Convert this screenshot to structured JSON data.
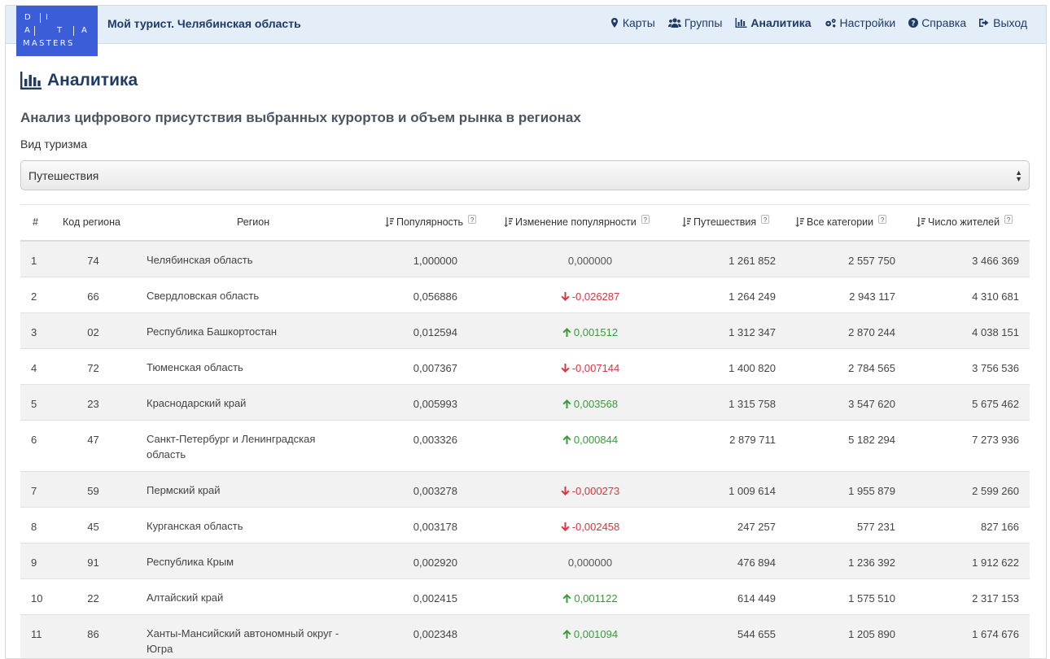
{
  "header": {
    "logo_letters": [
      "D",
      "I",
      "A",
      "T",
      "A",
      "MASTERS"
    ],
    "app_title": "Мой турист. Челябинская область",
    "nav": [
      {
        "label": "Карты",
        "icon": "map-marker-icon"
      },
      {
        "label": "Группы",
        "icon": "users-icon"
      },
      {
        "label": "Аналитика",
        "icon": "bar-chart-icon",
        "active": true
      },
      {
        "label": "Настройки",
        "icon": "gears-icon"
      },
      {
        "label": "Справка",
        "icon": "question-circle-icon"
      },
      {
        "label": "Выход",
        "icon": "sign-out-icon"
      }
    ]
  },
  "page": {
    "title": "Аналитика",
    "subtitle": "Анализ цифрового присутствия выбранных курортов и объем рынка в регионах",
    "tourism_label": "Вид туризма",
    "tourism_selected": "Путешествия"
  },
  "table": {
    "headers": {
      "num": "#",
      "code": "Код региона",
      "region": "Регион",
      "popularity": "Популярность",
      "change": "Изменение популярности",
      "travel": "Путешествия",
      "all": "Все категории",
      "population": "Число жителей",
      "help": "?"
    },
    "rows": [
      {
        "num": "1",
        "code": "74",
        "region": "Челябинская область",
        "popularity": "1,000000",
        "change": "0,000000",
        "dir": "flat",
        "travel": "1 261 852",
        "all": "2 557 750",
        "population": "3 466 369"
      },
      {
        "num": "2",
        "code": "66",
        "region": "Свердловская область",
        "popularity": "0,056886",
        "change": "-0,026287",
        "dir": "down",
        "travel": "1 264 249",
        "all": "2 943 117",
        "population": "4 310 681"
      },
      {
        "num": "3",
        "code": "02",
        "region": "Республика Башкортостан",
        "popularity": "0,012594",
        "change": "0,001512",
        "dir": "up",
        "travel": "1 312 347",
        "all": "2 870 244",
        "population": "4 038 151"
      },
      {
        "num": "4",
        "code": "72",
        "region": "Тюменская область",
        "popularity": "0,007367",
        "change": "-0,007144",
        "dir": "down",
        "travel": "1 400 820",
        "all": "2 784 565",
        "population": "3 756 536"
      },
      {
        "num": "5",
        "code": "23",
        "region": "Краснодарский край",
        "popularity": "0,005993",
        "change": "0,003568",
        "dir": "up",
        "travel": "1 315 758",
        "all": "3 547 620",
        "population": "5 675 462"
      },
      {
        "num": "6",
        "code": "47",
        "region": "Санкт-Петербург и Ленинградская область",
        "popularity": "0,003326",
        "change": "0,000844",
        "dir": "up",
        "travel": "2 879 711",
        "all": "5 182 294",
        "population": "7 273 936"
      },
      {
        "num": "7",
        "code": "59",
        "region": "Пермский край",
        "popularity": "0,003278",
        "change": "-0,000273",
        "dir": "down",
        "travel": "1 009 614",
        "all": "1 955 879",
        "population": "2 599 260"
      },
      {
        "num": "8",
        "code": "45",
        "region": "Курганская область",
        "popularity": "0,003178",
        "change": "-0,002458",
        "dir": "down",
        "travel": "247 257",
        "all": "577 231",
        "population": "827 166"
      },
      {
        "num": "9",
        "code": "91",
        "region": "Республика Крым",
        "popularity": "0,002920",
        "change": "0,000000",
        "dir": "flat",
        "travel": "476 894",
        "all": "1 236 392",
        "population": "1 912 622"
      },
      {
        "num": "10",
        "code": "22",
        "region": "Алтайский край",
        "popularity": "0,002415",
        "change": "0,001122",
        "dir": "up",
        "travel": "614 449",
        "all": "1 575 510",
        "population": "2 317 153"
      },
      {
        "num": "11",
        "code": "86",
        "region": "Ханты-Мансийский автономный округ - Югра",
        "popularity": "0,002348",
        "change": "0,001094",
        "dir": "up",
        "travel": "544 655",
        "all": "1 205 890",
        "population": "1 674 676"
      }
    ]
  },
  "colors": {
    "header_bg": "#e4eef9",
    "logo_bg": "#3b5ed8",
    "title": "#1d3b66",
    "down": "#d9343f",
    "up": "#3a9a3a"
  }
}
